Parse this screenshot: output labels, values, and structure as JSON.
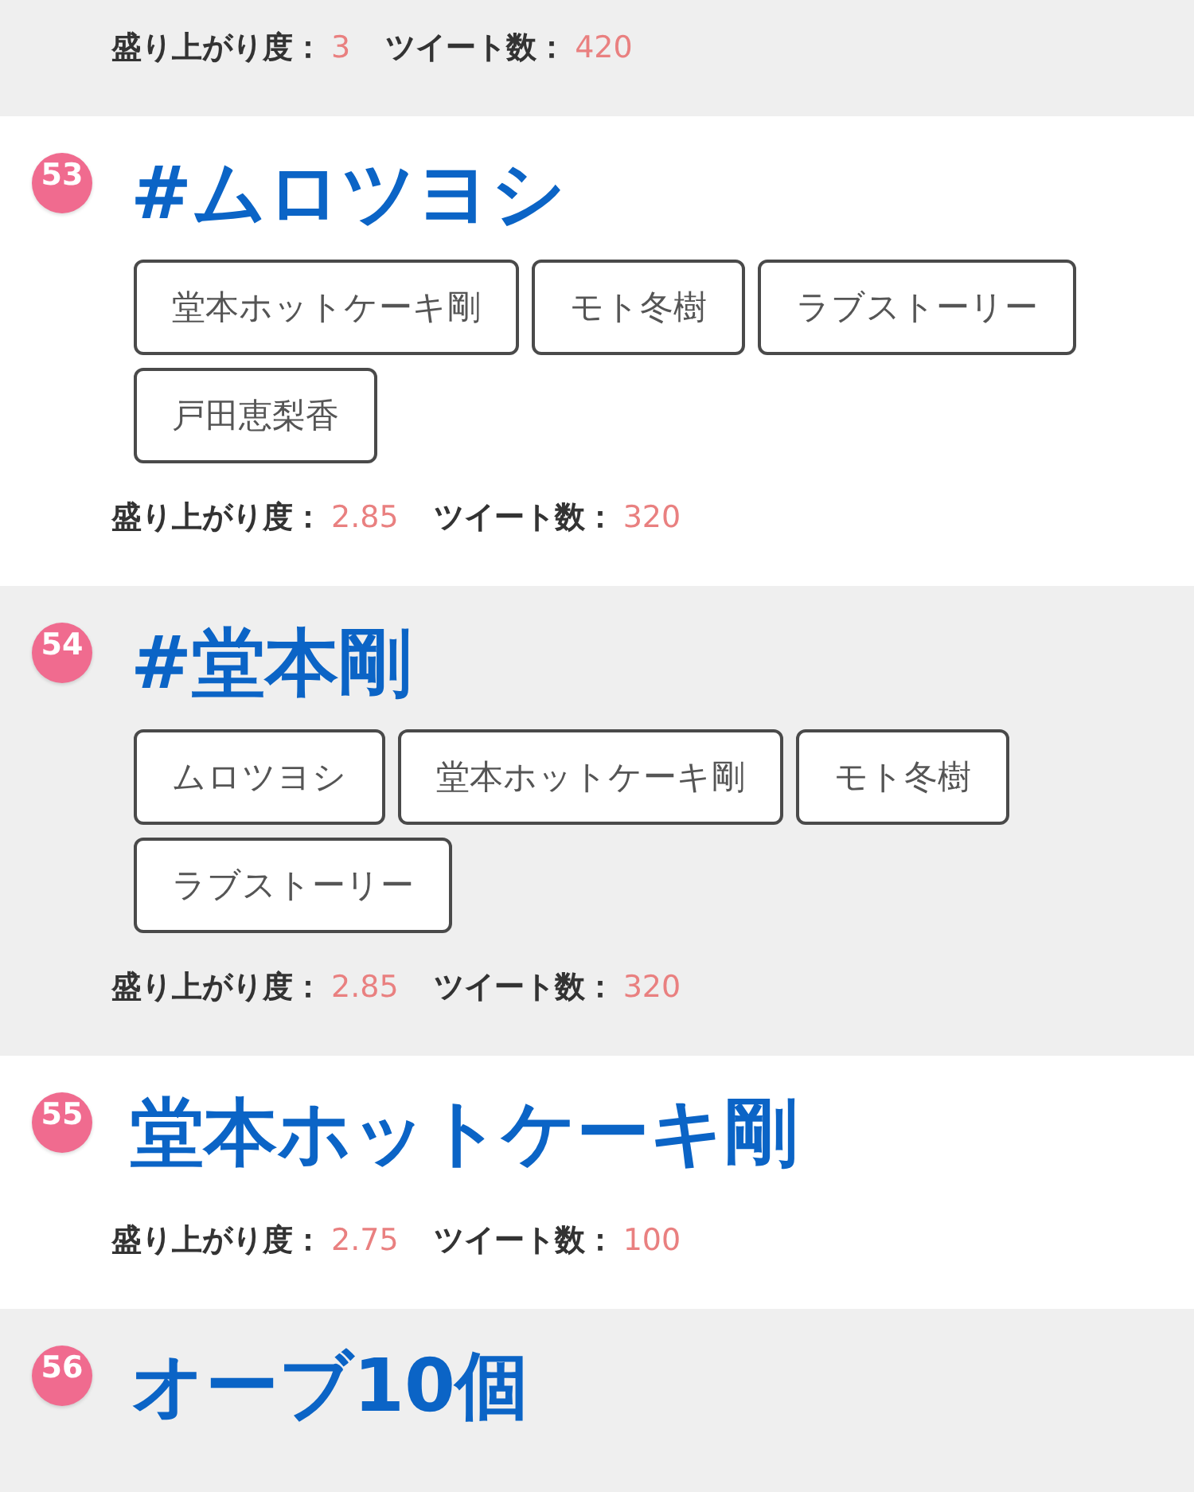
{
  "trends": [
    {
      "stats": [
        {
          "label": "盛り上がり度：",
          "value": "3"
        },
        {
          "label": "ツイート数：",
          "value": "420"
        }
      ]
    },
    {
      "rank": "53",
      "title": "#ムロツヨシ",
      "tags": [
        "堂本ホットケーキ剛",
        "モト冬樹",
        "ラブストーリー",
        "戸田恵梨香"
      ],
      "stats": [
        {
          "label": "盛り上がり度：",
          "value": "2.85"
        },
        {
          "label": "ツイート数：",
          "value": "320"
        }
      ]
    },
    {
      "rank": "54",
      "title": "#堂本剛",
      "tags": [
        "ムロツヨシ",
        "堂本ホットケーキ剛",
        "モト冬樹",
        "ラブストーリー"
      ],
      "stats": [
        {
          "label": "盛り上がり度：",
          "value": "2.85"
        },
        {
          "label": "ツイート数：",
          "value": "320"
        }
      ]
    },
    {
      "rank": "55",
      "title": "堂本ホットケーキ剛",
      "stats": [
        {
          "label": "盛り上がり度：",
          "value": "2.75"
        },
        {
          "label": "ツイート数：",
          "value": "100"
        }
      ]
    },
    {
      "rank": "56",
      "title": "オーブ10個"
    }
  ]
}
